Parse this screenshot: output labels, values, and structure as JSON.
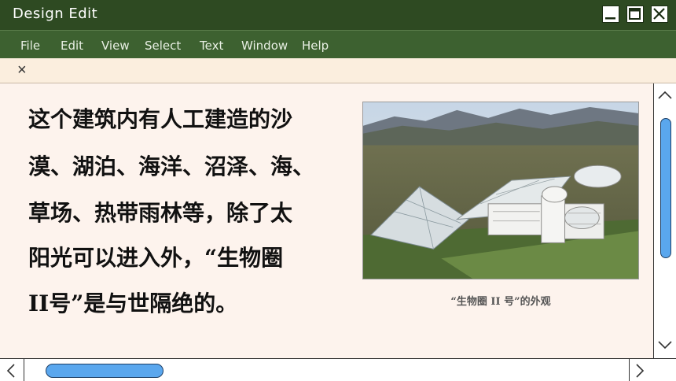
{
  "window": {
    "title": "Design Edit"
  },
  "menu": [
    "File",
    "Edit",
    "View",
    "Select",
    "Text",
    "Window",
    "Help"
  ],
  "tab": {
    "close_glyph": "×"
  },
  "content": {
    "lines": [
      "这个建筑内有人工建造的沙",
      "漠、湖泊、海洋、沼泽、海、",
      "草场、热带雨林等，除了太",
      "阳光可以进入外，“生物圈",
      "II号”是与世隔绝的。"
    ],
    "image_caption": "“生物圈 II 号”的外观"
  },
  "icons": {
    "minimize": "minimize-icon",
    "maximize": "maximize-icon",
    "close": "close-icon",
    "scroll_up": "chevron-up-icon",
    "scroll_down": "chevron-down-icon",
    "scroll_left": "chevron-left-icon",
    "scroll_right": "chevron-right-icon"
  },
  "colors": {
    "titlebar": "#2e4a22",
    "menubar": "#3d6130",
    "tabbar": "#fbeede",
    "content_bg": "#fdf3ed",
    "scroll_thumb": "#5aa7ee"
  }
}
